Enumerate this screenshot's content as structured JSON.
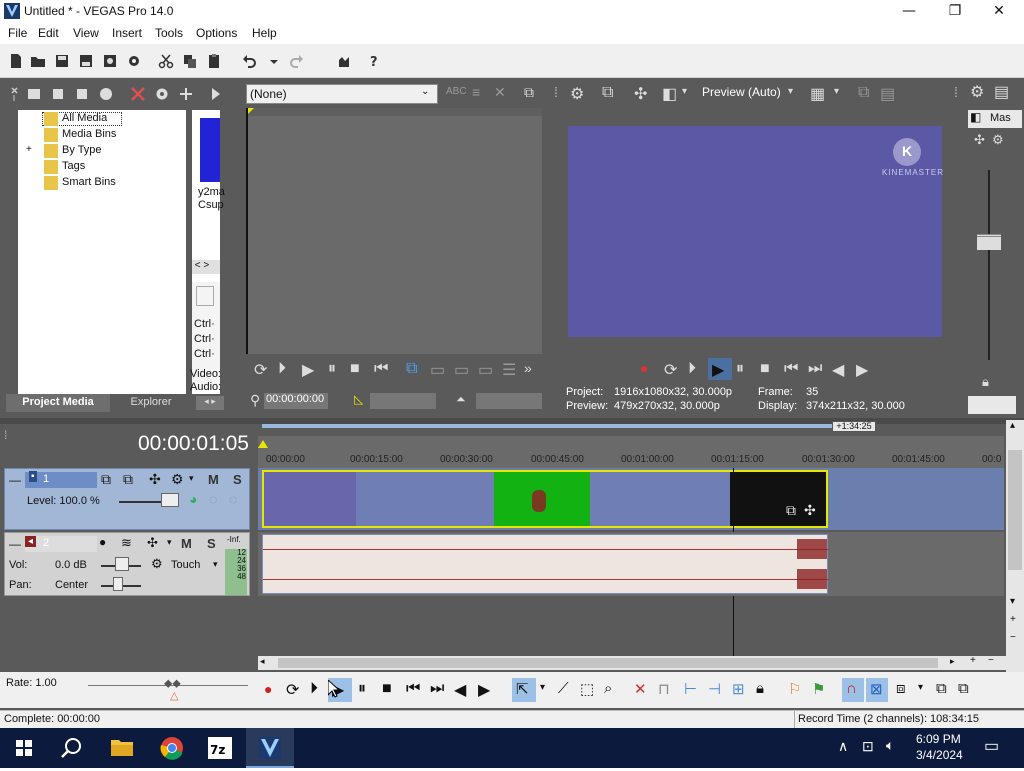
{
  "window": {
    "title": "Untitled * - VEGAS Pro 14.0",
    "minimize": "—",
    "maximize": "❐",
    "close": "✕"
  },
  "menu": [
    "File",
    "Edit",
    "View",
    "Insert",
    "Tools",
    "Options",
    "Help"
  ],
  "project_media": {
    "tree": [
      "All Media",
      "Media Bins",
      "By Type",
      "Tags",
      "Smart Bins"
    ],
    "expander": "+",
    "thumb_caption_1": "y2ma",
    "thumb_caption_2": "Csup",
    "ctrl_lines": [
      "Ctrl·",
      "Ctrl·",
      "Ctrl·"
    ],
    "video_label": "Video:",
    "audio_label": "Audio:",
    "tab_project_media": "Project Media",
    "tab_explorer": "Explorer"
  },
  "trimmer": {
    "dropdown_value": "(None)",
    "timecode": "00:00:00:00"
  },
  "preview": {
    "mode": "Preview (Auto)",
    "watermark": "KINEMASTER",
    "project_label": "Project:",
    "project_value": "1916x1080x32, 30.000p",
    "preview_label": "Preview:",
    "preview_value": "479x270x32, 30.000p",
    "frame_label": "Frame:",
    "frame_value": "35",
    "display_label": "Display:",
    "display_value": "374x211x32, 30.000",
    "master_label": "Mas"
  },
  "timeline": {
    "timecode": "00:00:01:05",
    "end_marker": "+1:34:25",
    "ruler": [
      "00:00:00",
      "00:00:15:00",
      "00:00:30:00",
      "00:00:45:00",
      "00:01:00:00",
      "00:01:15:00",
      "00:01:30:00",
      "00:01:45:00",
      "00:0"
    ],
    "track1": {
      "number": "1",
      "level": "Level: 100.0 %",
      "m": "M",
      "s": "S"
    },
    "track2": {
      "number": "2",
      "vol_label": "Vol:",
      "vol_value": "0.0 dB",
      "pan_label": "Pan:",
      "pan_value": "Center",
      "touch": "Touch",
      "m": "M",
      "s": "S",
      "meter": [
        "-Inf.",
        "12",
        "24",
        "36",
        "48"
      ]
    },
    "rate": "Rate: 1.00"
  },
  "status": {
    "complete": "Complete: 00:00:00",
    "record_time": "Record Time (2 channels): 108:34:15"
  },
  "taskbar": {
    "time": "6:09 PM",
    "date": "3/4/2024",
    "apps": [
      "windows-start",
      "search",
      "file-explorer",
      "chrome",
      "7zip",
      "vegas"
    ]
  },
  "colors": {
    "preview_bg": "#5b58a6",
    "green_clip": "#11b211",
    "clip_blue": "#6f7fb5",
    "audio_track": "#eee4e0",
    "accent": "#3a82d6"
  }
}
